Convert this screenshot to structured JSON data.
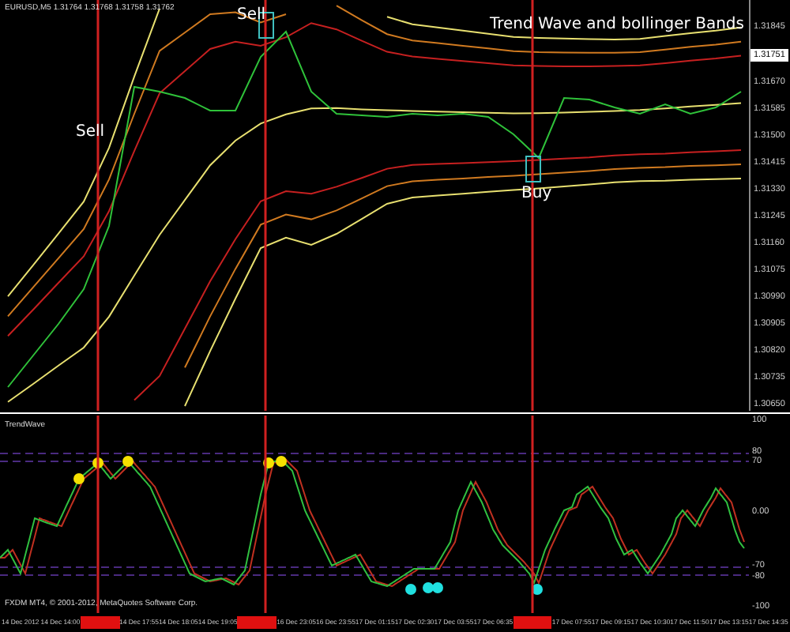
{
  "chart": {
    "quote": "1.31764 1.31768 1.31758 1.31762",
    "caption": "Trend Wave and bollinger Bands",
    "signals": [
      {
        "kind": "sell",
        "label": "Sell"
      },
      {
        "kind": "sell",
        "label": "Sell"
      },
      {
        "kind": "buy",
        "label": "Buy"
      }
    ],
    "current_price": "1.31751",
    "chart_data": {
      "type": "line",
      "ylim": [
        1.3063,
        1.3193
      ],
      "yticks": [
        {
          "value": 1.31845,
          "label": "1.31845"
        },
        {
          "value": 1.3167,
          "label": "1.31670"
        },
        {
          "value": 1.31585,
          "label": "1.31585"
        },
        {
          "value": 1.315,
          "label": "1.31500"
        },
        {
          "value": 1.31415,
          "label": "1.31415"
        },
        {
          "value": 1.3133,
          "label": "1.31330"
        },
        {
          "value": 1.31245,
          "label": "1.31245"
        },
        {
          "value": 1.3116,
          "label": "1.31160"
        },
        {
          "value": 1.31075,
          "label": "1.31075"
        },
        {
          "value": 1.3099,
          "label": "1.30990"
        },
        {
          "value": 1.30905,
          "label": "1.30905"
        },
        {
          "value": 1.3082,
          "label": "1.30820"
        },
        {
          "value": 1.30735,
          "label": "1.30735"
        },
        {
          "value": 1.3065,
          "label": "1.30650"
        }
      ],
      "series": [
        {
          "color": "#e8e070",
          "values": [
            1.30992,
            1.31091,
            1.31191,
            1.31292,
            1.31462,
            1.31688,
            1.31903,
            null,
            null,
            null,
            null,
            null,
            null,
            null,
            null,
            1.31877,
            1.31853,
            1.31843,
            1.31833,
            1.31823,
            1.31813,
            1.3181,
            1.31808,
            1.31806,
            1.31805,
            1.31807,
            1.31816,
            1.31825,
            1.31833,
            1.31843
          ]
        },
        {
          "color": "#d07a20",
          "values": [
            1.30929,
            1.31021,
            1.31113,
            1.31205,
            1.31362,
            1.3157,
            1.31769,
            1.31827,
            1.31885,
            1.31891,
            1.31859,
            1.31885,
            null,
            1.31912,
            1.31866,
            1.31822,
            1.31802,
            1.31794,
            1.31785,
            1.31777,
            1.31768,
            1.31765,
            1.31764,
            1.31763,
            1.31763,
            1.31765,
            1.31773,
            1.31782,
            1.31789,
            1.31798
          ]
        },
        {
          "color": "#c62020",
          "values": [
            1.30867,
            1.3095,
            1.31035,
            1.31119,
            1.31262,
            1.31452,
            1.31635,
            1.31705,
            1.31775,
            1.31798,
            1.31785,
            1.31812,
            1.31857,
            1.31837,
            1.31801,
            1.31766,
            1.31751,
            1.31744,
            1.31737,
            1.3173,
            1.31723,
            1.31721,
            1.3172,
            1.3172,
            1.31721,
            1.31723,
            1.3173,
            1.31738,
            1.31745,
            1.31754
          ]
        },
        {
          "color": "#e8e070",
          "values": [
            1.30658,
            1.30715,
            1.30773,
            1.3083,
            1.30928,
            1.31058,
            1.31187,
            1.31297,
            1.31407,
            1.31485,
            1.31539,
            1.31568,
            1.31587,
            1.31588,
            1.31584,
            1.31581,
            1.31579,
            1.31577,
            1.31575,
            1.31573,
            1.31571,
            1.31572,
            1.31574,
            1.31576,
            1.31579,
            1.31582,
            1.31587,
            1.31593,
            1.31598,
            1.31604
          ]
        },
        {
          "color": "#c62020",
          "values": [
            null,
            null,
            null,
            null,
            null,
            1.30664,
            1.3074,
            1.3089,
            1.3104,
            1.31173,
            1.31293,
            1.31325,
            1.31317,
            1.31339,
            1.31367,
            1.31396,
            1.31408,
            1.31411,
            1.31414,
            1.31417,
            1.3142,
            1.31424,
            1.31428,
            1.31432,
            1.31438,
            1.31442,
            1.31444,
            1.31448,
            1.31451,
            1.31455
          ]
        },
        {
          "color": "#d07a20",
          "values": [
            null,
            null,
            null,
            null,
            null,
            null,
            null,
            1.30767,
            1.30929,
            1.31079,
            1.31219,
            1.31251,
            1.31236,
            1.31264,
            1.31302,
            1.31341,
            1.31356,
            1.31361,
            1.31365,
            1.3137,
            1.31374,
            1.31379,
            1.31384,
            1.31389,
            1.31395,
            1.31399,
            1.31401,
            1.31405,
            1.31407,
            1.3141
          ]
        },
        {
          "color": "#e8e070",
          "values": [
            null,
            null,
            null,
            null,
            null,
            null,
            null,
            1.30645,
            1.30819,
            1.30985,
            1.31145,
            1.31178,
            1.31155,
            1.3119,
            1.31237,
            1.31285,
            1.31305,
            1.31311,
            1.31317,
            1.31323,
            1.31329,
            1.31334,
            1.3134,
            1.31346,
            1.31353,
            1.31357,
            1.31358,
            1.31361,
            1.31363,
            1.31365
          ]
        },
        {
          "name": "EURUSD,M5",
          "color": "#2fc23a",
          "values": [
            1.30705,
            1.30805,
            1.30905,
            1.31015,
            1.31215,
            1.31655,
            1.3164,
            1.3162,
            1.3158,
            1.3158,
            1.3175,
            1.3183,
            1.3164,
            1.3157,
            1.31565,
            1.3156,
            1.3157,
            1.31565,
            1.3157,
            1.3156,
            1.31505,
            1.3143,
            1.3162,
            1.31615,
            1.3159,
            1.3157,
            1.316,
            1.3157,
            1.3159,
            1.3164
          ]
        }
      ]
    }
  },
  "indicator": {
    "title": "TrendWave",
    "axis": [
      "100",
      "80",
      "70",
      "0.00",
      "-70",
      "-80",
      "-100"
    ],
    "copyright": "FXDM MT4, © 2001-2012, MetaQuotes Software Corp."
  },
  "time_axis": [
    {
      "kind": "label",
      "text": "14 Dec 2012"
    },
    {
      "kind": "label",
      "text": "14 Dec 14:00"
    },
    {
      "kind": "marker"
    },
    {
      "kind": "label",
      "text": "14 Dec 17:55"
    },
    {
      "kind": "label",
      "text": "14 Dec 18:05"
    },
    {
      "kind": "label",
      "text": "14 Dec 19:05"
    },
    {
      "kind": "marker"
    },
    {
      "kind": "label",
      "text": "16 Dec 23:05"
    },
    {
      "kind": "label",
      "text": "16 Dec 23:55"
    },
    {
      "kind": "label",
      "text": "17 Dec 01:15"
    },
    {
      "kind": "label",
      "text": "17 Dec 02:30"
    },
    {
      "kind": "label",
      "text": "17 Dec 03:55"
    },
    {
      "kind": "label",
      "text": "17 Dec 06:35"
    },
    {
      "kind": "marker"
    },
    {
      "kind": "label",
      "text": "17 Dec 07:55"
    },
    {
      "kind": "label",
      "text": "17 Dec 09:15"
    },
    {
      "kind": "label",
      "text": "17 Dec 10:30"
    },
    {
      "kind": "label",
      "text": "17 Dec 11:50"
    },
    {
      "kind": "label",
      "text": "17 Dec 13:15"
    },
    {
      "kind": "label",
      "text": "17 Dec 14:35"
    }
  ]
}
